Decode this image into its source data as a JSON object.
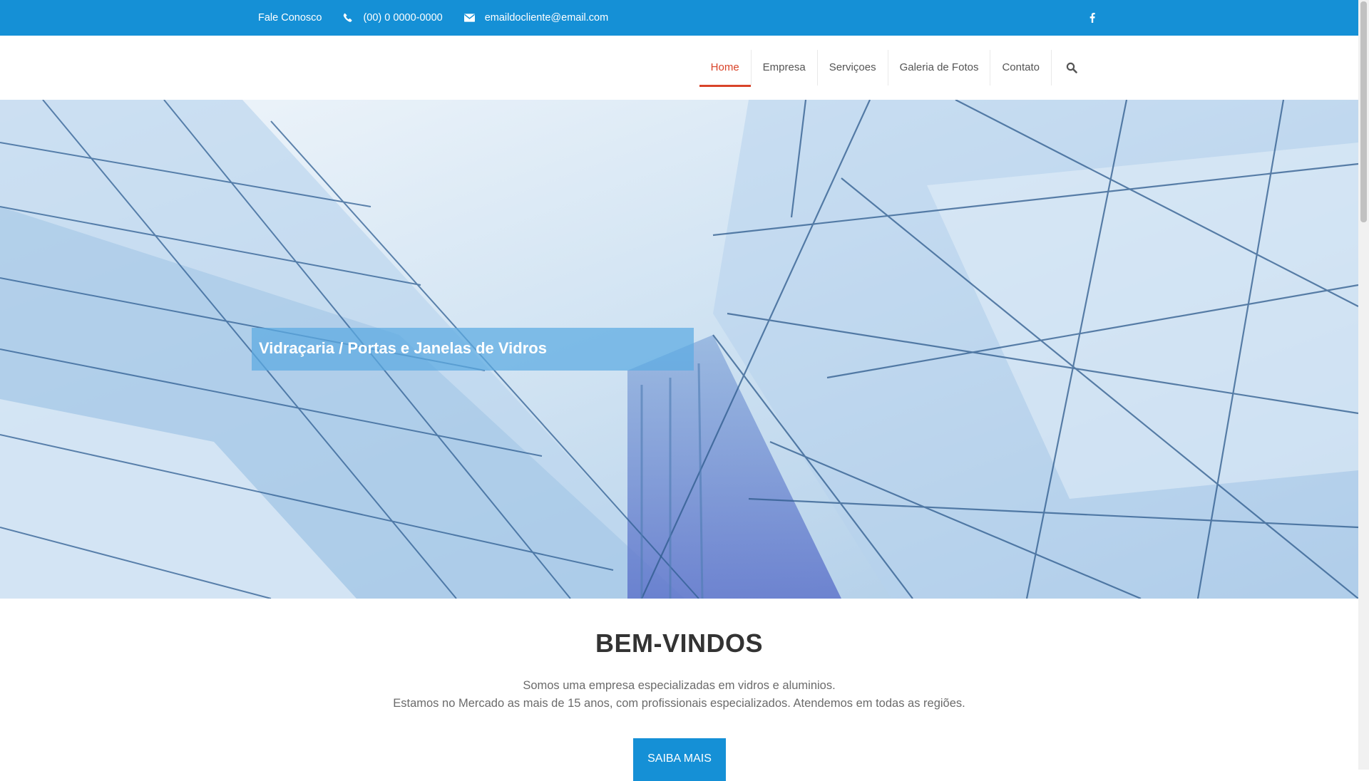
{
  "topbar": {
    "contact_label": "Fale Conosco",
    "phone": "(00) 0 0000-0000",
    "email": "emaildocliente@email.com",
    "phone_icon": "phone-icon",
    "email_icon": "envelope-icon",
    "social_icon": "facebook-icon",
    "background": "#1590d6"
  },
  "nav": {
    "items": [
      {
        "label": "Home",
        "active": true
      },
      {
        "label": "Empresa"
      },
      {
        "label": "Serviçoes"
      },
      {
        "label": "Galeria de Fotos"
      },
      {
        "label": "Contato"
      }
    ],
    "search_icon": "search-icon",
    "active_color": "#d9442a"
  },
  "hero": {
    "caption": "Vidraçaria / Portas e Janelas de Vidros"
  },
  "welcome": {
    "title": "BEM-VINDOS",
    "line1": "Somos uma empresa especializadas em vidros e aluminios.",
    "line2": "Estamos no Mercado as mais de 15 anos, com profissionais especializados. Atendemos em todas as regiões.",
    "button": "SAIBA MAIS"
  }
}
